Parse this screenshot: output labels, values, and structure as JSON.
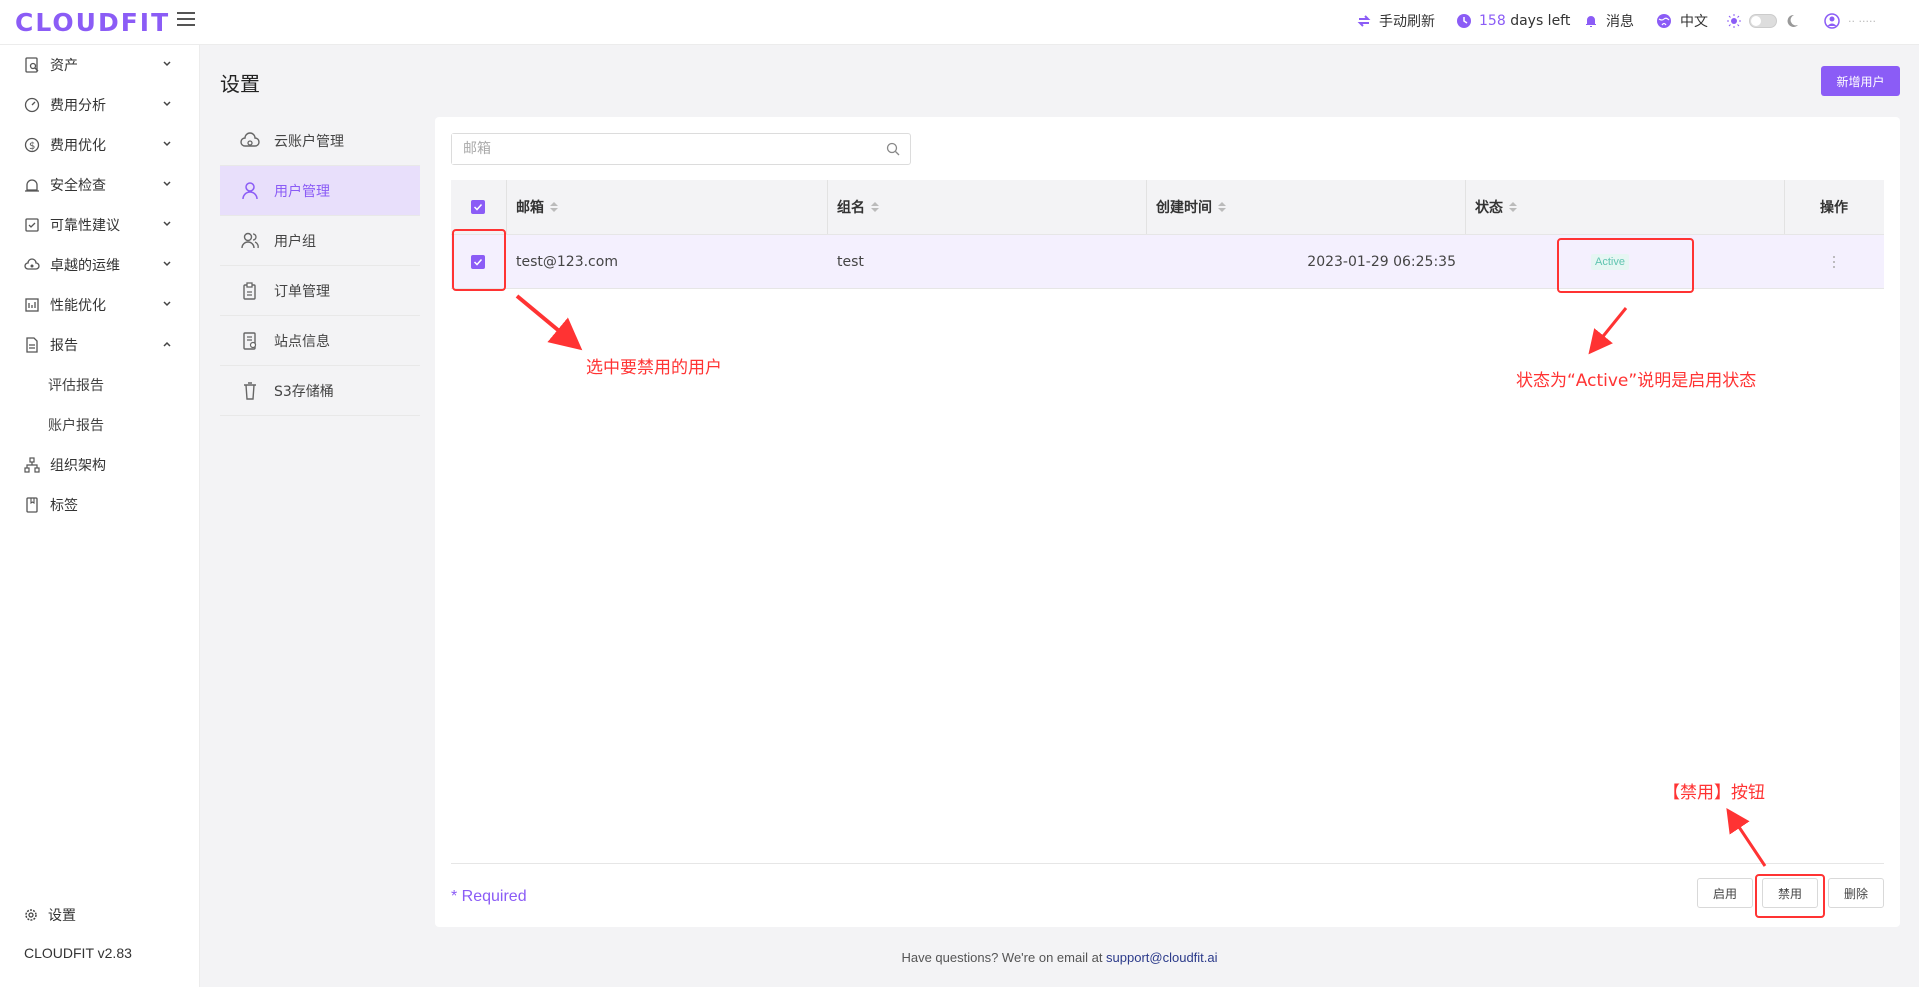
{
  "header": {
    "logo": "CLOUDFIT",
    "refresh_label": "手动刷新",
    "days_count": "158",
    "days_suffix": "days left",
    "messages_label": "消息",
    "language_label": "中文",
    "user_name": "·· ·····"
  },
  "sidebar": {
    "items": [
      {
        "label": "资产",
        "icon": "asset-icon"
      },
      {
        "label": "费用分析",
        "icon": "gauge-icon"
      },
      {
        "label": "费用优化",
        "icon": "dollar-icon"
      },
      {
        "label": "安全检查",
        "icon": "alarm-icon"
      },
      {
        "label": "可靠性建议",
        "icon": "checklist-icon"
      },
      {
        "label": "卓越的运维",
        "icon": "cloud-gear-icon"
      },
      {
        "label": "性能优化",
        "icon": "chart-icon"
      },
      {
        "label": "报告",
        "icon": "report-icon"
      }
    ],
    "sub_items": [
      "评估报告",
      "账户报告"
    ],
    "bottom_items": [
      {
        "label": "组织架构",
        "icon": "org-icon"
      },
      {
        "label": "标签",
        "icon": "tag-icon"
      }
    ],
    "settings_label": "设置",
    "version": "CLOUDFIT v2.83"
  },
  "page": {
    "title": "设置",
    "add_user_label": "新增用户"
  },
  "settings_menu": [
    {
      "label": "云账户管理",
      "icon": "cloud-account-icon"
    },
    {
      "label": "用户管理",
      "icon": "user-icon",
      "active": true
    },
    {
      "label": "用户组",
      "icon": "user-group-icon"
    },
    {
      "label": "订单管理",
      "icon": "order-icon"
    },
    {
      "label": "站点信息",
      "icon": "site-icon"
    },
    {
      "label": "S3存储桶",
      "icon": "bucket-icon"
    }
  ],
  "search": {
    "placeholder": "邮箱"
  },
  "table": {
    "columns": [
      "邮箱",
      "组名",
      "创建时间",
      "状态",
      "操作"
    ],
    "rows": [
      {
        "email": "test@123.com",
        "group": "test",
        "created": "2023-01-29 06:25:35",
        "status": "Active"
      }
    ]
  },
  "footer": {
    "required": "* Required",
    "enable_label": "启用",
    "disable_label": "禁用",
    "delete_label": "删除"
  },
  "bottom_note": {
    "text": "Have questions? We're on email at ",
    "email": "support@cloudfit.ai"
  },
  "annotations": {
    "select_user": "选中要禁用的用户",
    "status_active": "状态为“Active”说明是启用状态",
    "disable_button": "【禁用】按钮"
  },
  "colors": {
    "accent": "#8b5cf6",
    "annotation": "#ff3333",
    "active_badge": "#5fc4b0"
  }
}
